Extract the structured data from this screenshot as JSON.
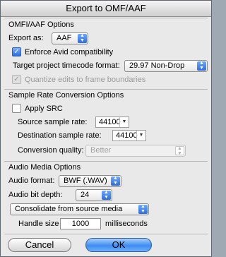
{
  "window": {
    "title": "Export to OMF/AAF"
  },
  "omfi": {
    "title": "OMFI/AAF Options",
    "export_as_label": "Export as:",
    "export_as_value": "AAF",
    "enforce_label": "Enforce Avid compatibility",
    "enforce_checked": true,
    "timecode_label": "Target project timecode format:",
    "timecode_value": "29.97 Non-Drop",
    "quantize_label": "Quantize edits to frame boundaries",
    "quantize_checked": true,
    "quantize_enabled": false
  },
  "src": {
    "title": "Sample Rate Conversion Options",
    "apply_label": "Apply SRC",
    "apply_checked": false,
    "source_label": "Source sample rate:",
    "source_value": "44100",
    "dest_label": "Destination sample rate:",
    "dest_value": "44100",
    "quality_label": "Conversion quality:",
    "quality_value": "Better"
  },
  "audio": {
    "title": "Audio Media Options",
    "format_label": "Audio format:",
    "format_value": "BWF (.WAV)",
    "bitdepth_label": "Audio bit depth:",
    "bitdepth_value": "24",
    "consolidate_value": "Consolidate from source media",
    "handle_label": "Handle size",
    "handle_value": "1000",
    "handle_units": "milliseconds"
  },
  "buttons": {
    "cancel": "Cancel",
    "ok": "OK"
  }
}
